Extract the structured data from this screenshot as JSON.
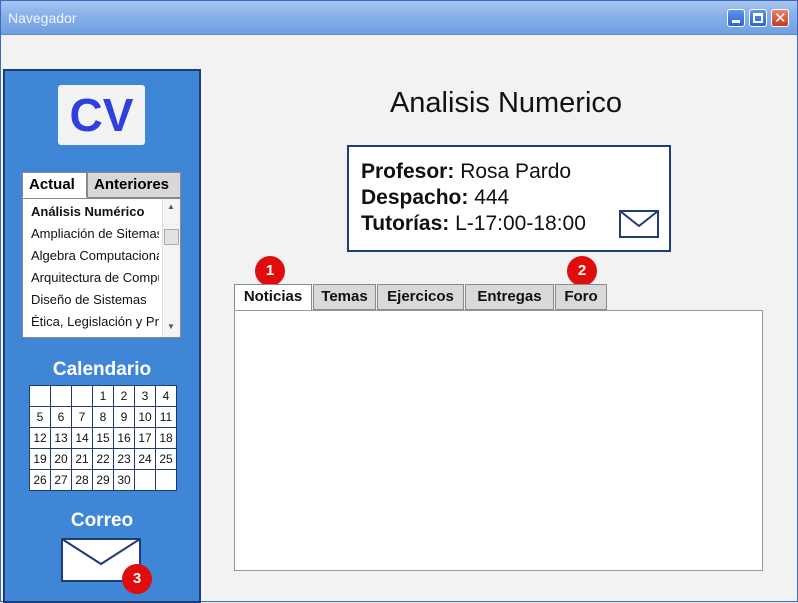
{
  "window": {
    "title": "Navegador"
  },
  "sidebar": {
    "logo": "CV",
    "course_tabs": [
      {
        "label": "Actual",
        "selected": true
      },
      {
        "label": "Anteriores",
        "selected": false
      }
    ],
    "courses": [
      "Análisis Numérico",
      "Ampliación de Sitemas",
      "Algebra Computacional",
      "Arquitectura de Computadores",
      "Diseño de Sistemas",
      "Ética, Legislación y Profesión"
    ],
    "calendar_title": "Calendario",
    "calendar_weeks": [
      [
        "",
        "",
        "",
        "1",
        "2",
        "3",
        "4"
      ],
      [
        "5",
        "6",
        "7",
        "8",
        "9",
        "10",
        "11"
      ],
      [
        "12",
        "13",
        "14",
        "15",
        "16",
        "17",
        "18"
      ],
      [
        "19",
        "20",
        "21",
        "22",
        "23",
        "24",
        "25"
      ],
      [
        "26",
        "27",
        "28",
        "29",
        "30",
        "",
        ""
      ]
    ],
    "mail_title": "Correo"
  },
  "main": {
    "title": "Analisis Numerico",
    "info": {
      "profesor_label": "Profesor:",
      "profesor_value": "Rosa Pardo",
      "despacho_label": "Despacho:",
      "despacho_value": "444",
      "tutorias_label": "Tutorías:",
      "tutorias_value": "L-17:00-18:00"
    },
    "tabs": [
      {
        "label": "Noticias",
        "selected": true
      },
      {
        "label": "Temas",
        "selected": false
      },
      {
        "label": "Ejercicos",
        "selected": false
      },
      {
        "label": "Entregas",
        "selected": false
      },
      {
        "label": "Foro",
        "selected": false
      }
    ]
  },
  "annotations": [
    "1",
    "2",
    "3"
  ],
  "icons": {
    "mail": "mail-icon",
    "minimize": "minimize-icon",
    "maximize": "maximize-icon",
    "close": "close-icon"
  },
  "colors": {
    "sidebar": "#3f86d6",
    "sidebar_border": "#1f3b78",
    "badge": "#e00d0d",
    "logo_text": "#2f3fe0"
  }
}
